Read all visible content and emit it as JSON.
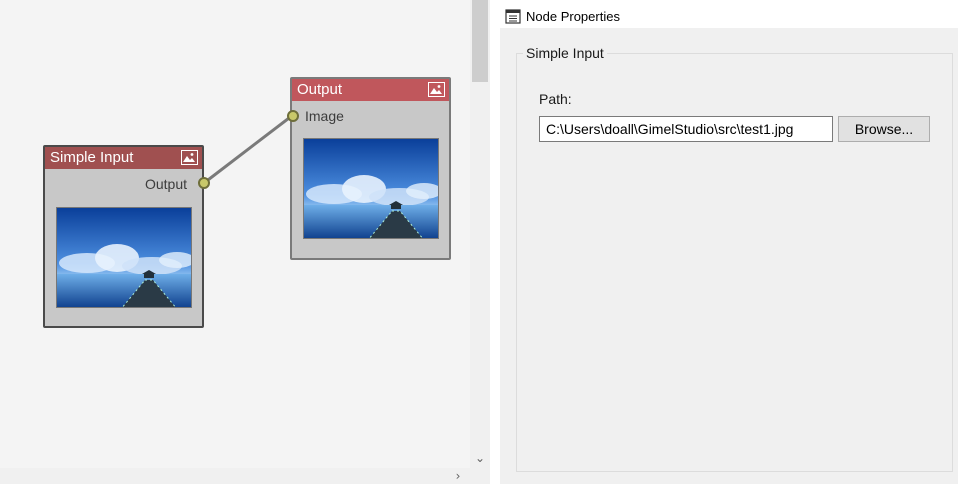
{
  "canvas": {
    "nodes": {
      "simple_input": {
        "title": "Simple Input",
        "output_label": "Output",
        "icon": "image-icon"
      },
      "output": {
        "title": "Output",
        "input_label": "Image",
        "icon": "image-icon"
      }
    },
    "scrollbar": {
      "down_arrow": "⌄",
      "right_arrow": "›"
    }
  },
  "properties": {
    "header_title": "Node Properties",
    "group_title": "Simple Input",
    "path_label": "Path:",
    "path_value": "C:\\Users\\doall\\GimelStudio\\src\\test1.jpg",
    "browse_label": "Browse..."
  },
  "colors": {
    "input_header": "#a05050",
    "output_header": "#c0575c",
    "socket": "#c8c86a",
    "canvas_bg": "#f4f4f4"
  }
}
